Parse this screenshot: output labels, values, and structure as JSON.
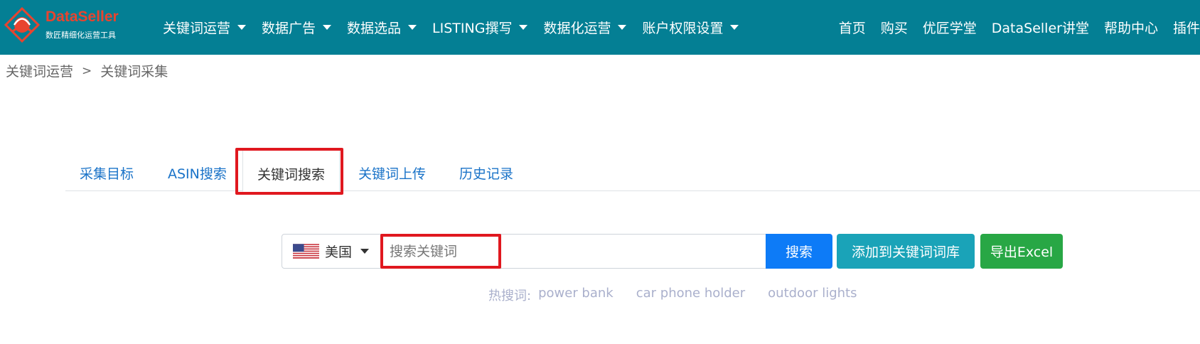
{
  "brand": {
    "name": "DataSeller",
    "tagline": "数匠精细化运营工具"
  },
  "nav": {
    "menu": [
      {
        "label": "关键词运营",
        "icon": "caret-down-icon"
      },
      {
        "label": "数据广告",
        "icon": "caret-down-icon"
      },
      {
        "label": "数据选品",
        "icon": "caret-down-icon"
      },
      {
        "label": "LISTING撰写",
        "icon": "caret-down-icon"
      },
      {
        "label": "数据化运营",
        "icon": "caret-down-icon"
      },
      {
        "label": "账户权限设置",
        "icon": "caret-down-icon"
      }
    ],
    "links": [
      "首页",
      "购买",
      "优匠学堂",
      "DataSeller讲堂",
      "帮助中心",
      "插件"
    ]
  },
  "breadcrumb": {
    "items": [
      "关键词运营",
      "关键词采集"
    ],
    "separator": ">"
  },
  "tabs": {
    "items": [
      "采集目标",
      "ASIN搜索",
      "关键词搜索",
      "关键词上传",
      "历史记录"
    ],
    "active": "关键词搜索"
  },
  "search": {
    "country": "美国",
    "country_flag": "us-flag-icon",
    "value": "",
    "placeholder": "搜索关键词",
    "search_label": "搜索",
    "add_label": "添加到关键词词库",
    "export_label": "导出Excel"
  },
  "hot_words": {
    "label": "热搜词:",
    "items": [
      "power bank",
      "car phone holder",
      "outdoor lights"
    ]
  },
  "colors": {
    "navbar": "#047f94",
    "brand_red": "#e8442f",
    "highlight_red": "#e0181f",
    "search_button": "#0d7bf7",
    "add_button": "#1aa3b8",
    "export_button": "#28a745",
    "tab_link": "#1a73c8"
  }
}
